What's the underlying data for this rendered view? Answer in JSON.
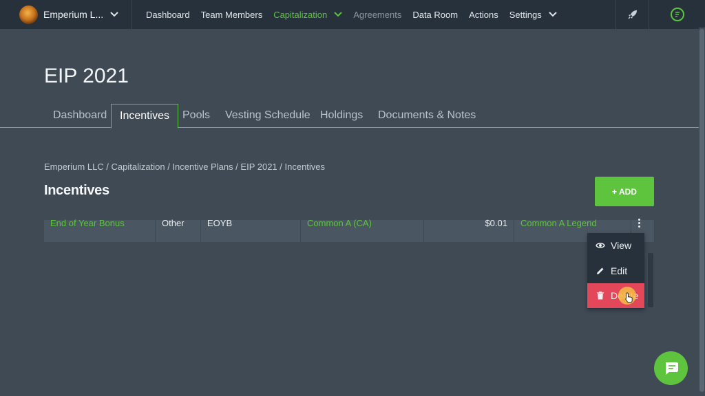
{
  "topbar": {
    "company_name": "Emperium L...",
    "nav": [
      {
        "label": "Dashboard",
        "state": "normal"
      },
      {
        "label": "Team Members",
        "state": "normal"
      },
      {
        "label": "Capitalization",
        "state": "active"
      },
      {
        "label": "Agreements",
        "state": "disabled"
      },
      {
        "label": "Data Room",
        "state": "normal"
      },
      {
        "label": "Actions",
        "state": "normal"
      },
      {
        "label": "Settings",
        "state": "normal"
      }
    ]
  },
  "page": {
    "title": "EIP 2021",
    "tabs": [
      {
        "label": "Dashboard"
      },
      {
        "label": "Incentives"
      },
      {
        "label": "Pools"
      },
      {
        "label": "Vesting Schedule"
      },
      {
        "label": "Holdings"
      },
      {
        "label": "Documents & Notes"
      }
    ],
    "active_tab": "Incentives",
    "breadcrumb": "Emperium LLC / Capitalization / Incentive Plans / EIP 2021 / Incentives",
    "section_title": "Incentives",
    "add_button": "+ ADD"
  },
  "table": {
    "rows": [
      {
        "name": "End of Year Bonus",
        "type": "Other",
        "code": "EOYB",
        "class": "Common A (CA)",
        "price": "$0.01",
        "legend": "Common A Legend"
      }
    ]
  },
  "menu": {
    "items": [
      {
        "label": "View",
        "icon": "eye-icon"
      },
      {
        "label": "Edit",
        "icon": "pencil-icon"
      },
      {
        "label": "Delete",
        "icon": "trash-icon"
      }
    ]
  },
  "colors": {
    "accent": "#5ec43d",
    "danger": "#e2475a",
    "background": "#3f4a55",
    "topbar": "#27313b"
  }
}
